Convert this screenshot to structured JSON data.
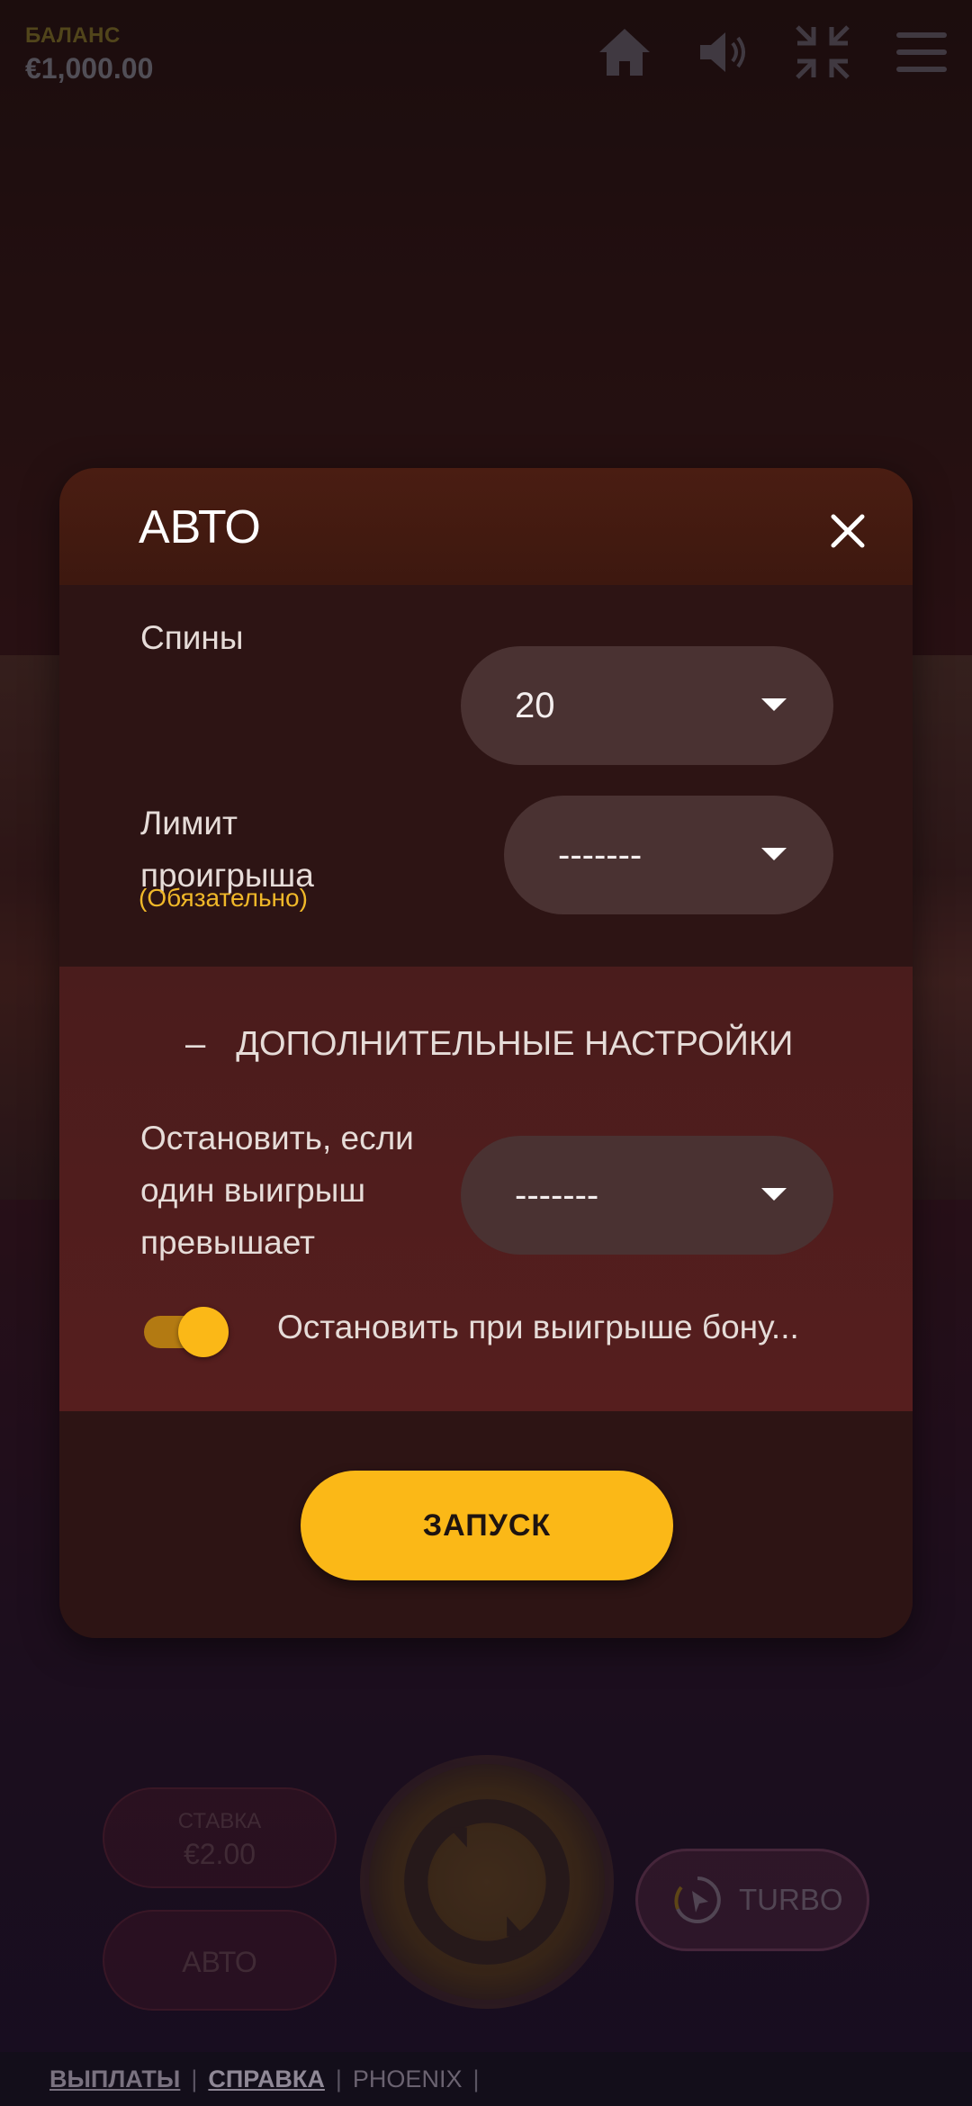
{
  "balance": {
    "label": "БАЛАНС",
    "value": "€1,000.00"
  },
  "top_icons": [
    "home-icon",
    "sound-icon",
    "fullscreen-exit-icon",
    "menu-icon"
  ],
  "modal": {
    "title": "АВТО",
    "spins": {
      "label": "Спины",
      "value": "20"
    },
    "loss_limit": {
      "label_line1": "Лимит",
      "label_line2": "проигрыша",
      "hint": "(Обязательно)",
      "value": "-------"
    },
    "advanced": {
      "toggle_symbol": "–",
      "title": "ДОПОЛНИТЕЛЬНЫЕ НАСТРОЙКИ",
      "single_win": {
        "label_line1": "Остановить, если",
        "label_line2": "один выигрыш",
        "label_line3": "превышает",
        "value": "-------"
      },
      "bonus_stop": {
        "label": "Остановить при выигрыше бону...",
        "enabled": true
      }
    },
    "launch_label": "ЗАПУСК"
  },
  "controls": {
    "stake_label": "СТАВКА",
    "stake_value": "€2.00",
    "auto_label": "АВТО",
    "turbo_label": "TURBO"
  },
  "footer": {
    "payouts": "ВЫПЛАТЫ",
    "help": "СПРАВКА",
    "provider": "PHOENIX",
    "sep": "|"
  },
  "colors": {
    "accent": "#fbb817",
    "hint": "#f0b829"
  }
}
